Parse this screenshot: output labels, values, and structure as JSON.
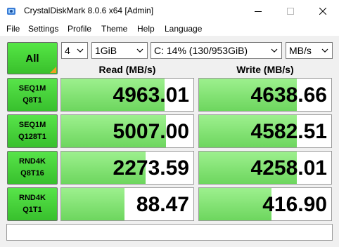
{
  "window": {
    "title": "CrystalDiskMark 8.0.6 x64 [Admin]",
    "minimize_glyph": "—",
    "maximize_glyph": "☐",
    "close_glyph": "✕"
  },
  "menu": {
    "items": [
      "File",
      "Settings",
      "Profile",
      "Theme",
      "Help",
      "Language"
    ]
  },
  "controls": {
    "all_label": "All",
    "count": "4",
    "size": "1GiB",
    "drive": "C: 14% (130/953GiB)",
    "unit": "MB/s"
  },
  "headers": {
    "read": "Read (MB/s)",
    "write": "Write (MB/s)"
  },
  "rows": [
    {
      "line1": "SEQ1M",
      "line2": "Q8T1",
      "read": "4963.01",
      "write": "4638.66",
      "read_fill": 0.78,
      "write_fill": 0.74
    },
    {
      "line1": "SEQ1M",
      "line2": "Q128T1",
      "read": "5007.00",
      "write": "4582.51",
      "read_fill": 0.79,
      "write_fill": 0.74
    },
    {
      "line1": "RND4K",
      "line2": "Q8T16",
      "read": "2273.59",
      "write": "4258.01",
      "read_fill": 0.64,
      "write_fill": 0.74
    },
    {
      "line1": "RND4K",
      "line2": "Q1T1",
      "read": "88.47",
      "write": "416.90",
      "read_fill": 0.48,
      "write_fill": 0.55
    }
  ],
  "comment": "",
  "colors": {
    "accent_green": "#39c02c",
    "bar_green": "#6dd65e",
    "corner_orange": "#f0a020"
  }
}
